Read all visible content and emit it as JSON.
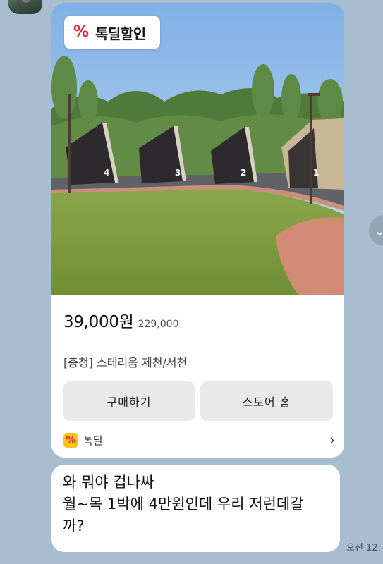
{
  "card": {
    "badge": {
      "icon": "tokdeal-percent-icon",
      "icon_glyph": "%",
      "label": "톡딜할인"
    },
    "price": "39,000원",
    "original_price": "229,000",
    "product_name": "[충청] 스테리움 제천/서천",
    "buttons": {
      "buy": "구매하기",
      "store": "스토어 홈"
    },
    "footer": {
      "icon": "tokdeal-icon",
      "icon_glyph": "%",
      "label": "톡딜",
      "chevron": "›"
    },
    "photo": {
      "cabin_numbers": [
        "4",
        "3",
        "2",
        "1"
      ]
    }
  },
  "message": {
    "lines": [
      "와 뭐야 겁나싸",
      "월~목 1박에 4만원인데 우리 저런데갈",
      "까?"
    ]
  },
  "timestamp": "오전 12:",
  "side_button": {
    "icon": "scroll-down-icon",
    "glyph": "⌄"
  },
  "colors": {
    "chat_background": "#a8bdcf",
    "bubble": "#ffffff",
    "button": "#e9e9e9",
    "badge_red": "#e6232e",
    "footer_icon_bg": "#f5c518"
  }
}
